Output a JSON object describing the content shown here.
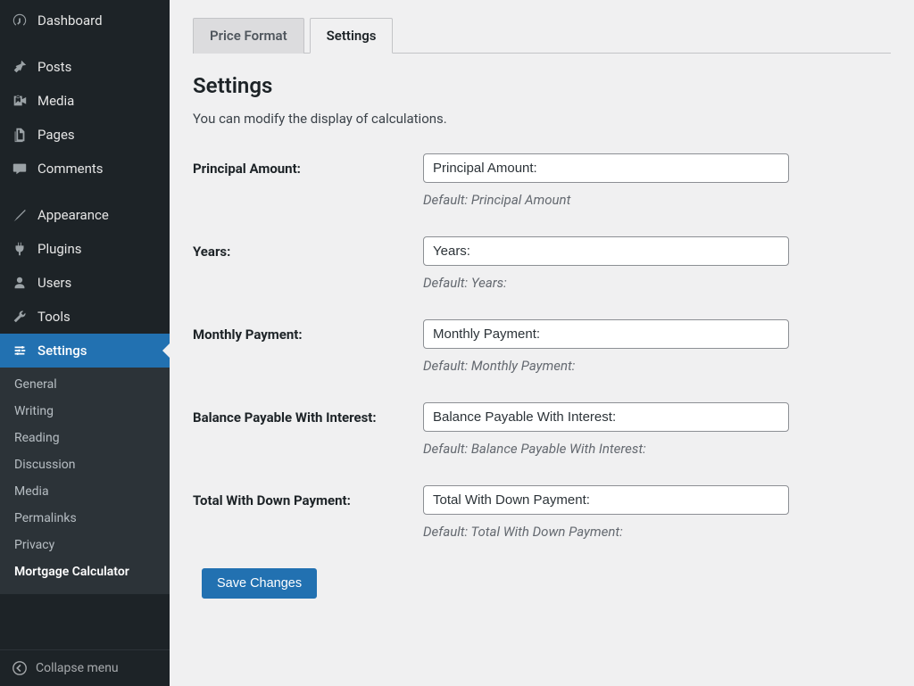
{
  "sidebar": {
    "main_items": [
      {
        "label": "Dashboard",
        "icon": "dashboard"
      },
      {
        "label": "Posts",
        "icon": "pin",
        "sep_before": true
      },
      {
        "label": "Media",
        "icon": "media"
      },
      {
        "label": "Pages",
        "icon": "pages"
      },
      {
        "label": "Comments",
        "icon": "comments"
      },
      {
        "label": "Appearance",
        "icon": "appearance",
        "sep_before": true
      },
      {
        "label": "Plugins",
        "icon": "plugins"
      },
      {
        "label": "Users",
        "icon": "users"
      },
      {
        "label": "Tools",
        "icon": "tools"
      },
      {
        "label": "Settings",
        "icon": "settings",
        "current": true
      }
    ],
    "submenu": [
      {
        "label": "General"
      },
      {
        "label": "Writing"
      },
      {
        "label": "Reading"
      },
      {
        "label": "Discussion"
      },
      {
        "label": "Media"
      },
      {
        "label": "Permalinks"
      },
      {
        "label": "Privacy"
      },
      {
        "label": "Mortgage Calculator",
        "active": true
      }
    ],
    "collapse_label": "Collapse menu"
  },
  "tabs": [
    {
      "label": "Price Format",
      "active": false
    },
    {
      "label": "Settings",
      "active": true
    }
  ],
  "page": {
    "heading": "Settings",
    "description": "You can modify the display of calculations."
  },
  "fields": [
    {
      "label": "Principal Amount:",
      "value": "Principal Amount:",
      "hint": "Default: Principal Amount"
    },
    {
      "label": "Years:",
      "value": "Years:",
      "hint": "Default: Years:"
    },
    {
      "label": "Monthly Payment:",
      "value": "Monthly Payment:",
      "hint": "Default: Monthly Payment:"
    },
    {
      "label": "Balance Payable With Interest:",
      "value": "Balance Payable With Interest:",
      "hint": "Default: Balance Payable With Interest:"
    },
    {
      "label": "Total With Down Payment:",
      "value": "Total With Down Payment:",
      "hint": "Default: Total With Down Payment:"
    }
  ],
  "buttons": {
    "save": "Save Changes"
  }
}
